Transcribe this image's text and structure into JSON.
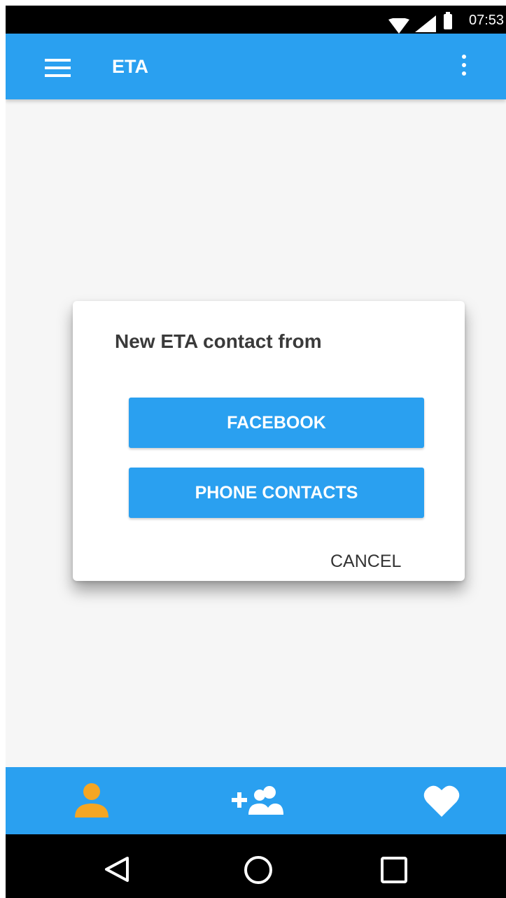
{
  "status_bar": {
    "time": "07:53",
    "icons": [
      "wifi-icon",
      "signal-icon",
      "battery-icon"
    ]
  },
  "app_bar": {
    "title": "ETA",
    "icons": [
      "menu-icon",
      "more-vert-icon"
    ],
    "color": "#2aa0f0"
  },
  "dialog": {
    "title": "New ETA contact from",
    "buttons": {
      "facebook": "FACEBOOK",
      "phone_contacts": "PHONE CONTACTS",
      "cancel": "CANCEL"
    }
  },
  "bottom_nav": {
    "items": [
      {
        "icon": "person-icon",
        "active": true,
        "color": "#f5a623"
      },
      {
        "icon": "add-group-icon",
        "active": false,
        "color": "#ffffff"
      },
      {
        "icon": "heart-icon",
        "active": false,
        "color": "#ffffff"
      }
    ]
  },
  "system_nav": {
    "icons": [
      "back-icon",
      "home-icon",
      "recents-icon"
    ]
  },
  "colors": {
    "primary": "#2aa0f0",
    "accent": "#f5a623",
    "background": "#f6f6f6"
  }
}
